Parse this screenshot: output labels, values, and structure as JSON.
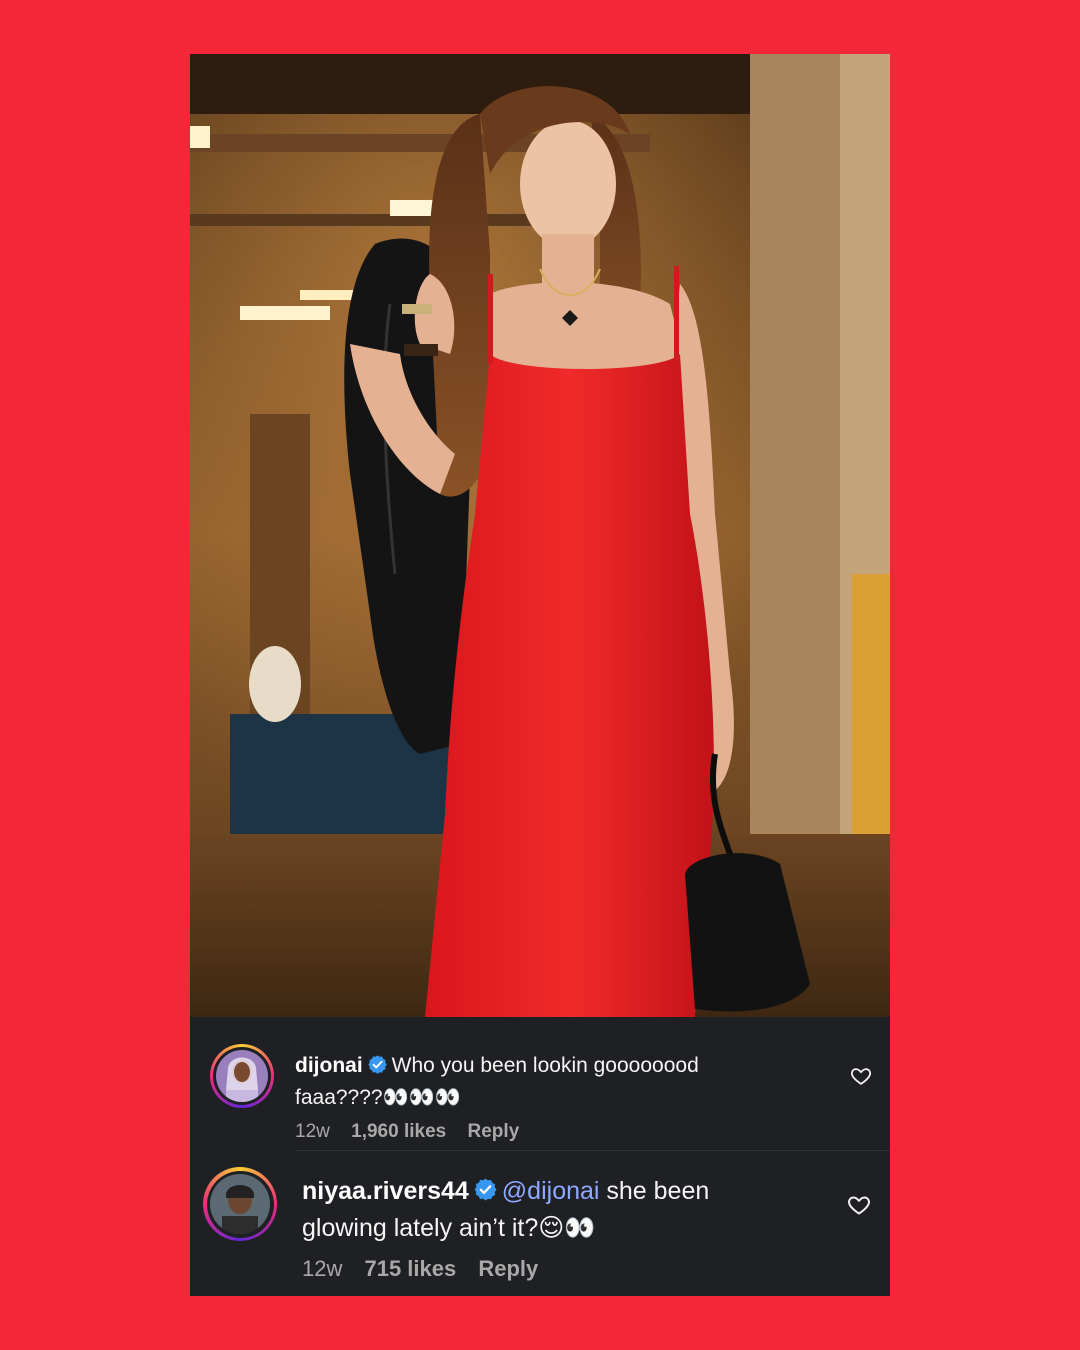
{
  "background_color": "#f32737",
  "post": {
    "image_alt_name": "photo-woman-red-dress"
  },
  "comments": [
    {
      "username": "dijonai",
      "verified": true,
      "text": "Who you been lookin goooooood faaa????👀👀👀",
      "time": "12w",
      "likes": "1,960 likes",
      "reply_label": "Reply"
    },
    {
      "username": "niyaa.rivers44",
      "verified": true,
      "mention": "@dijonai",
      "text": " she been glowing lately ain’t it?😌👀",
      "time": "12w",
      "likes": "715 likes",
      "reply_label": "Reply"
    }
  ],
  "icons": {
    "heart": "heart-icon",
    "verified": "verified-badge-icon"
  },
  "colors": {
    "panel": "#1f2023",
    "mention": "#8ea9ff",
    "verified": "#3897f0"
  }
}
